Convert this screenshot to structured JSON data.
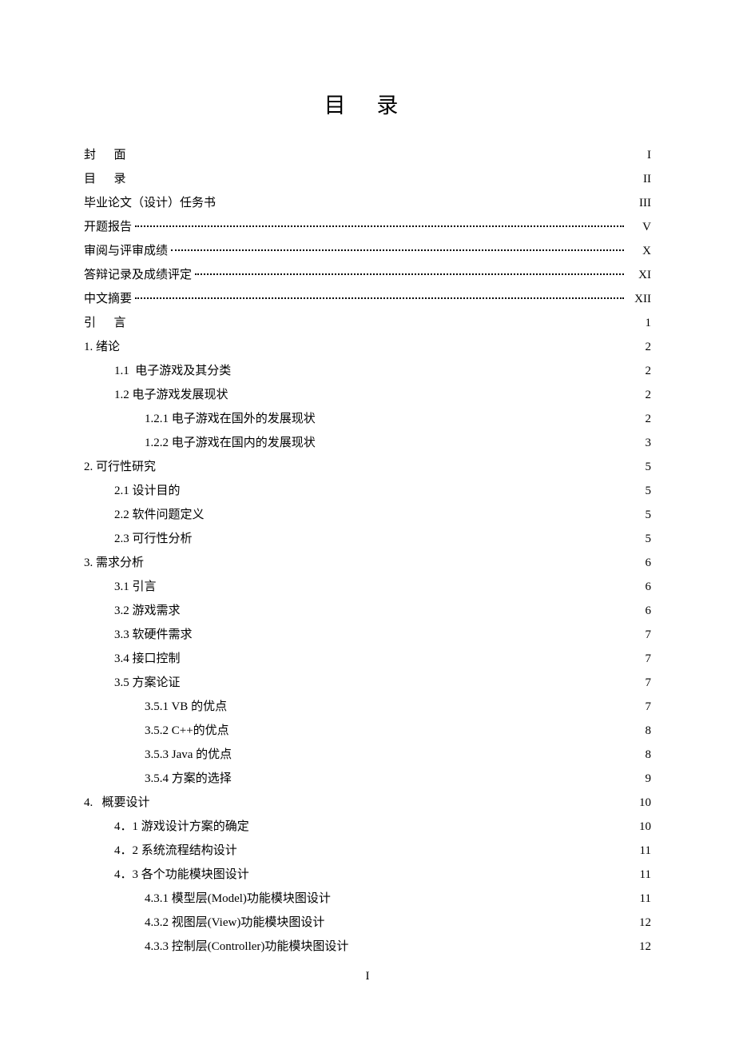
{
  "title": "目 录",
  "footer": "I",
  "items": [
    {
      "label": "封      面",
      "page": "I",
      "indent": 0,
      "dots": false
    },
    {
      "label": "目      录",
      "page": "II",
      "indent": 0,
      "dots": false
    },
    {
      "label": "毕业论文（设计）任务书",
      "page": "III",
      "indent": 0,
      "dots": false
    },
    {
      "label": "开题报告",
      "page": "V",
      "indent": 0,
      "dots": true
    },
    {
      "label": "审阅与评审成绩",
      "page": "X",
      "indent": 0,
      "dots": true
    },
    {
      "label": "答辩记录及成绩评定",
      "page": "XI",
      "indent": 0,
      "dots": true
    },
    {
      "label": "中文摘要",
      "page": "XII",
      "indent": 0,
      "dots": true
    },
    {
      "label": "引      言",
      "page": "1",
      "indent": 0,
      "dots": false
    },
    {
      "label": "1. 绪论",
      "page": "2",
      "indent": 0,
      "dots": false
    },
    {
      "label": "1.1  电子游戏及其分类",
      "page": "2",
      "indent": 1,
      "dots": false
    },
    {
      "label": "1.2 电子游戏发展现状",
      "page": "2",
      "indent": 1,
      "dots": false
    },
    {
      "label": "1.2.1 电子游戏在国外的发展现状",
      "page": "2",
      "indent": 2,
      "dots": false
    },
    {
      "label": "1.2.2 电子游戏在国内的发展现状",
      "page": "3",
      "indent": 2,
      "dots": false
    },
    {
      "label": "2. 可行性研究",
      "page": "5",
      "indent": 0,
      "dots": false
    },
    {
      "label": "2.1 设计目的",
      "page": "5",
      "indent": 1,
      "dots": false
    },
    {
      "label": "2.2 软件问题定义",
      "page": "5",
      "indent": 1,
      "dots": false
    },
    {
      "label": "2.3 可行性分析",
      "page": "5",
      "indent": 1,
      "dots": false
    },
    {
      "label": "3. 需求分析",
      "page": "6",
      "indent": 0,
      "dots": false
    },
    {
      "label": "3.1 引言",
      "page": "6",
      "indent": 1,
      "dots": false
    },
    {
      "label": "3.2 游戏需求",
      "page": "6",
      "indent": 1,
      "dots": false
    },
    {
      "label": "3.3 软硬件需求",
      "page": "7",
      "indent": 1,
      "dots": false
    },
    {
      "label": "3.4 接口控制",
      "page": "7",
      "indent": 1,
      "dots": false
    },
    {
      "label": "3.5 方案论证",
      "page": "7",
      "indent": 1,
      "dots": false
    },
    {
      "label": "3.5.1 VB 的优点",
      "page": "7",
      "indent": 2,
      "dots": false
    },
    {
      "label": "3.5.2 C++的优点",
      "page": "8",
      "indent": 2,
      "dots": false
    },
    {
      "label": "3.5.3 Java 的优点",
      "page": "8",
      "indent": 2,
      "dots": false
    },
    {
      "label": "3.5.4 方案的选择",
      "page": "9",
      "indent": 2,
      "dots": false
    },
    {
      "label": "4.   概要设计",
      "page": "10",
      "indent": 0,
      "dots": false
    },
    {
      "label": "4．1 游戏设计方案的确定",
      "page": "10",
      "indent": 1,
      "dots": false
    },
    {
      "label": "4．2 系统流程结构设计",
      "page": "11",
      "indent": 1,
      "dots": false
    },
    {
      "label": "4．3 各个功能模块图设计",
      "page": "11",
      "indent": 1,
      "dots": false
    },
    {
      "label": "4.3.1 模型层(Model)功能模块图设计",
      "page": "11",
      "indent": 2,
      "dots": false
    },
    {
      "label": "4.3.2 视图层(View)功能模块图设计",
      "page": "12",
      "indent": 2,
      "dots": false
    },
    {
      "label": "4.3.3 控制层(Controller)功能模块图设计",
      "page": "12",
      "indent": 2,
      "dots": false
    }
  ]
}
